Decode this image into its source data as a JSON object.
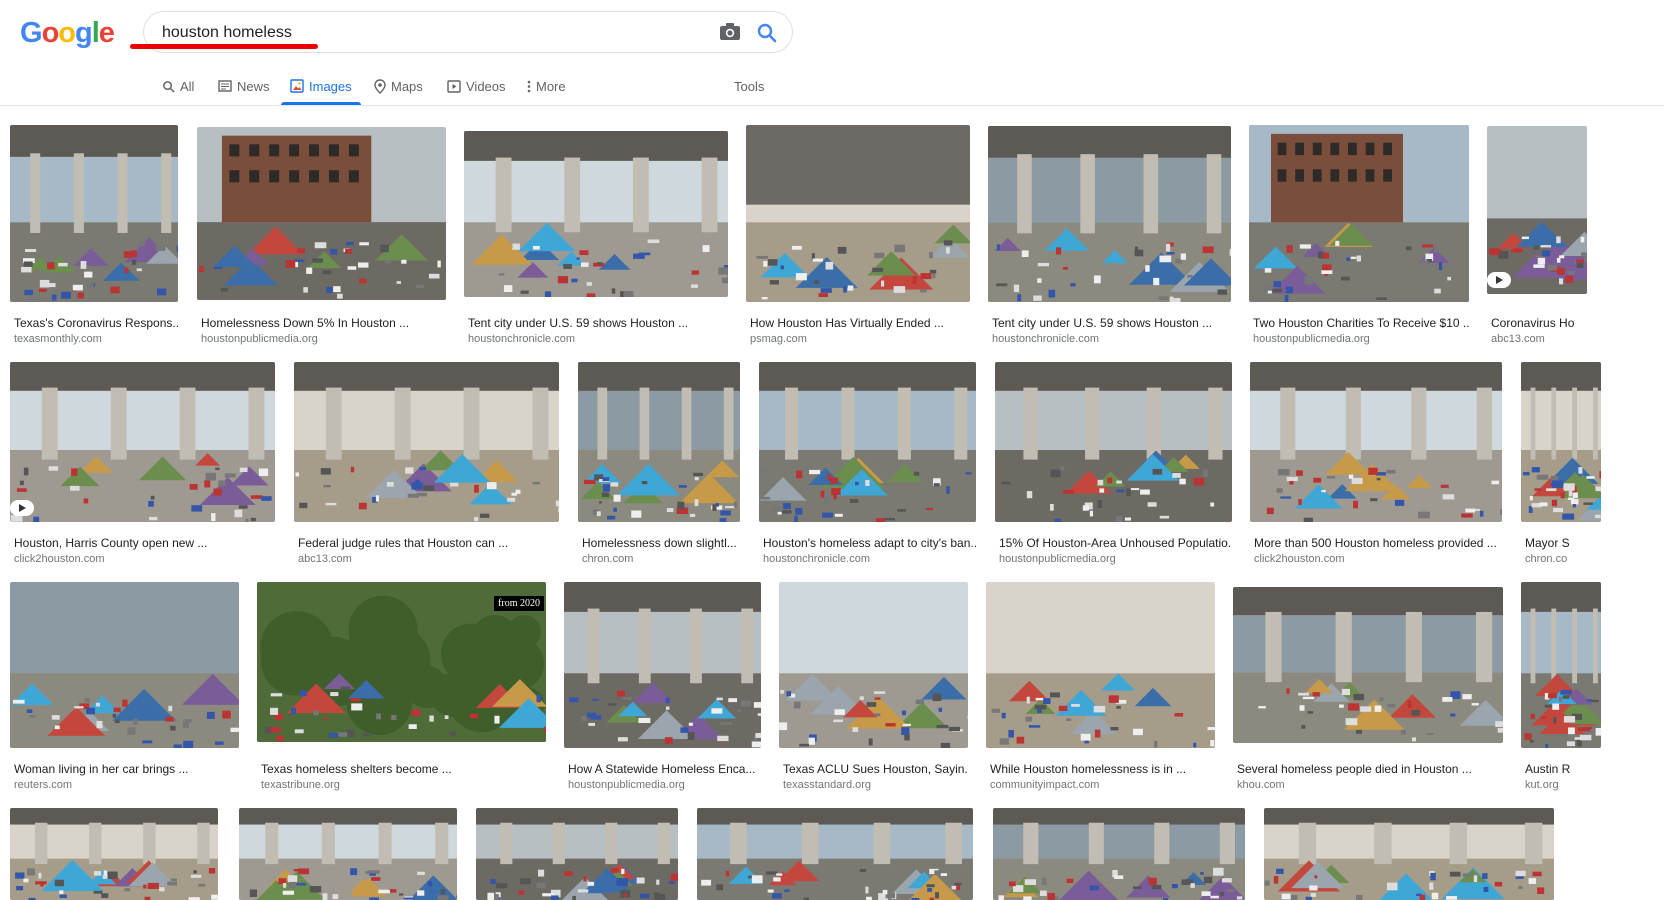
{
  "header": {
    "logo": [
      "G",
      "o",
      "o",
      "g",
      "l",
      "e"
    ],
    "search_value": "houston homeless",
    "camera_icon": "camera-icon",
    "search_icon": "search-icon"
  },
  "tabs": [
    {
      "label": "All",
      "icon": "search-icon"
    },
    {
      "label": "News",
      "icon": "news-icon"
    },
    {
      "label": "Images",
      "icon": "images-icon",
      "active": true
    },
    {
      "label": "Maps",
      "icon": "map-pin-icon"
    },
    {
      "label": "Videos",
      "icon": "video-icon"
    },
    {
      "label": "More",
      "icon": "more-vert-icon"
    },
    {
      "label": "Tools"
    }
  ],
  "results": [
    {
      "title": "Texas's Coronavirus Respons...",
      "source": "texasmonthly.com"
    },
    {
      "title": "Homelessness Down 5% In Houston ...",
      "source": "houstonpublicmedia.org"
    },
    {
      "title": "Tent city under U.S. 59 shows Houston ...",
      "source": "houstonchronicle.com"
    },
    {
      "title": "How Houston Has Virtually Ended ...",
      "source": "psmag.com"
    },
    {
      "title": "Tent city under U.S. 59 shows Houston ...",
      "source": "houstonchronicle.com"
    },
    {
      "title": "Two Houston Charities To Receive $10 ...",
      "source": "houstonpublicmedia.org"
    },
    {
      "title": "Coronavirus Ho",
      "source": "abc13.com"
    },
    {
      "title": "Houston, Harris County open new ...",
      "source": "click2houston.com"
    },
    {
      "title": "Federal judge rules that Houston can ...",
      "source": "abc13.com"
    },
    {
      "title": "Homelessness down slightl...",
      "source": "chron.com"
    },
    {
      "title": "Houston's homeless adapt to city's ban...",
      "source": "houstonchronicle.com"
    },
    {
      "title": "15% Of Houston-Area Unhoused Populatio...",
      "source": "houstonpublicmedia.org"
    },
    {
      "title": "More than 500 Houston homeless provided ...",
      "source": "click2houston.com"
    },
    {
      "title": "Mayor S",
      "source": "chron.co"
    },
    {
      "title": "Woman living in her car brings ...",
      "source": "reuters.com"
    },
    {
      "title": "Texas homeless shelters become ...",
      "source": "texastribune.org"
    },
    {
      "title": "How A Statewide Homeless Enca...",
      "source": "houstonpublicmedia.org"
    },
    {
      "title": "Texas ACLU Sues Houston, Sayin...",
      "source": "texasstandard.org"
    },
    {
      "title": "While Houston homelessness is in ...",
      "source": "communityimpact.com"
    },
    {
      "title": "Several homeless people died in Houston ...",
      "source": "khou.com"
    },
    {
      "title": "Austin R",
      "source": "kut.org"
    }
  ],
  "badge_text": "from 2020",
  "colors": {
    "accent": "#1a73e8",
    "logo": [
      "#4285f4",
      "#ea4335",
      "#fbbc05",
      "#4285f4",
      "#34a853",
      "#ea4335"
    ]
  }
}
